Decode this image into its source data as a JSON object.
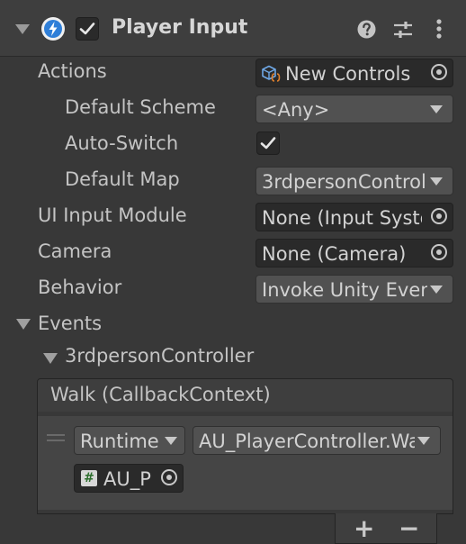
{
  "header": {
    "title": "Player Input",
    "enabled": true
  },
  "fields": {
    "actions_label": "Actions",
    "actions_value": "New Controls",
    "default_scheme_label": "Default Scheme",
    "default_scheme_value": "<Any>",
    "auto_switch_label": "Auto-Switch",
    "auto_switch_checked": true,
    "default_map_label": "Default Map",
    "default_map_value": "3rdpersonControl",
    "ui_input_module_label": "UI Input Module",
    "ui_input_module_value": "None (Input System UI Input Module)",
    "camera_label": "Camera",
    "camera_value": "None (Camera)",
    "behavior_label": "Behavior",
    "behavior_value": "Invoke Unity Events"
  },
  "events": {
    "label": "Events",
    "map_label": "3rdpersonController",
    "event_title": "Walk (CallbackContext)",
    "listener": {
      "runtime_value": "Runtime Only",
      "function_value": "AU_PlayerController.Walk",
      "object_value": "AU_PlayerController"
    },
    "add_label": "+",
    "remove_label": "−"
  },
  "colors": {
    "background": "#383838",
    "header_bg": "#3e3e3e",
    "field_bg": "#2a2a2a",
    "dropdown_bg": "#515151",
    "text": "#c4c4c4",
    "icon_blue": "#2f7fd8"
  }
}
